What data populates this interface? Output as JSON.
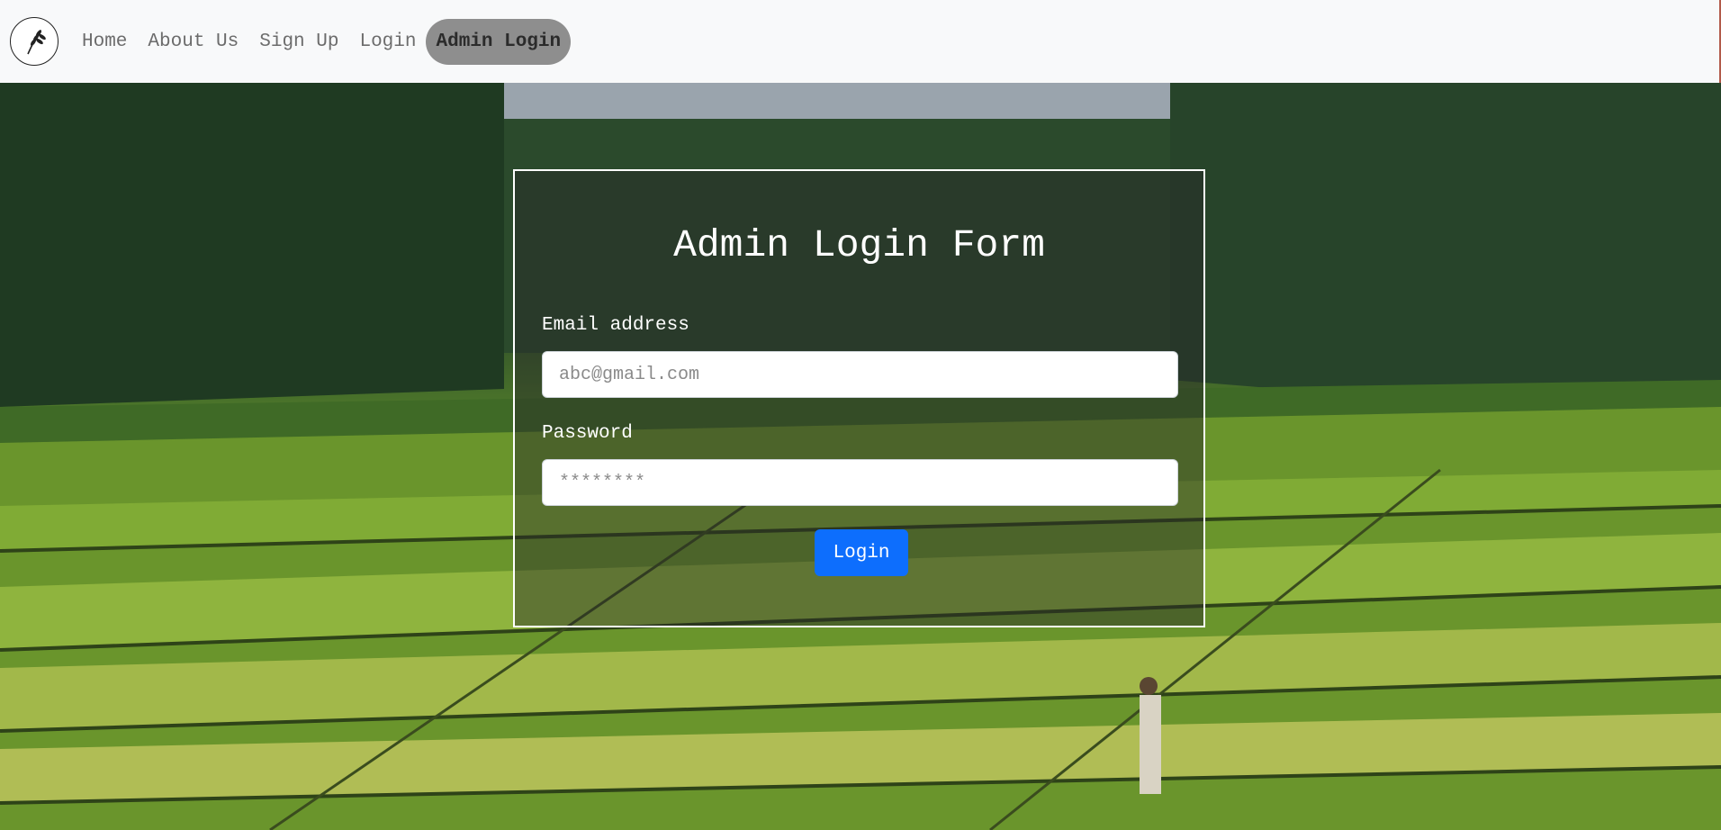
{
  "nav": {
    "logo_icon": "wheat-icon",
    "links": [
      "Home",
      "About Us",
      "Sign Up",
      "Login"
    ],
    "active_link": "Admin Login"
  },
  "form": {
    "title": "Admin Login Form",
    "email_label": "Email address",
    "email_placeholder": "abc@gmail.com",
    "password_label": "Password",
    "password_placeholder": "********",
    "submit_label": "Login"
  },
  "colors": {
    "navbar_bg": "#f8f9fa",
    "active_pill": "#8e8e8e",
    "primary_button": "#0d6efd"
  }
}
